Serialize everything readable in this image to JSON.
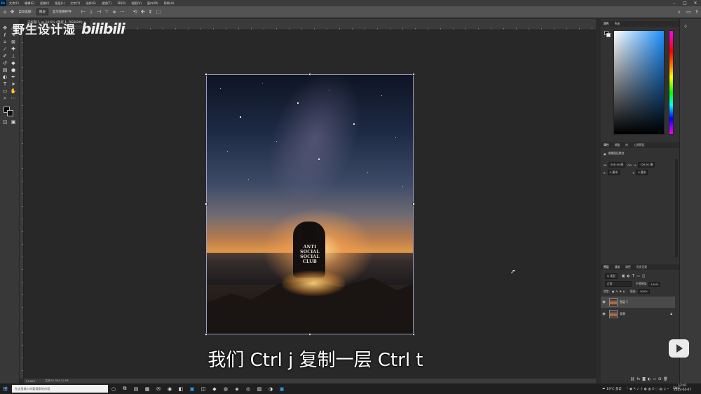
{
  "menubar": {
    "logo": "Ps",
    "items": [
      "文件(F)",
      "编辑(E)",
      "图像(I)",
      "图层(L)",
      "文字(Y)",
      "选择(S)",
      "滤镜(T)",
      "3D(D)",
      "视图(V)",
      "窗口(W)",
      "帮助(H)"
    ],
    "min": "–",
    "max": "□",
    "close": "✕"
  },
  "options": {
    "home": "⌂",
    "move": "✥",
    "auto_select": "自动选择:",
    "layer_dropdown": "图层",
    "show_transform": "显示变换控件",
    "more": "···"
  },
  "document": {
    "tab": "未标题-1 @ 24.6% (图层 1, RGB/8#) ×"
  },
  "watermark": {
    "text": "野生设计湿",
    "logo": "bilibili"
  },
  "subtitle": "我们 Ctrl j 复制一层 Ctrl t",
  "statusbar": {
    "zoom": "24.66%",
    "doc": "文档:55.7M/111.4M"
  },
  "panels": {
    "color_tabs": [
      "颜色",
      "色板"
    ],
    "properties_tabs": [
      "属性",
      "调整",
      "库",
      "工具预设"
    ],
    "properties_title": "像素图层属性",
    "w_label": "W:",
    "w_value": "506.49 厘",
    "h_label": "H:",
    "h_value": "126.91 厘",
    "go_label": "GO",
    "x_label": "X:",
    "x_value": "0 厘米",
    "y_label": "Y:",
    "y_value": "0 厘米",
    "layers_tabs": [
      "图层",
      "通道",
      "路径",
      "历史记录"
    ],
    "kind_label": "Q 类型",
    "blend_mode": "正常",
    "opacity_label": "不透明度:",
    "opacity_value": "100%",
    "lock_label": "锁定:",
    "fill_label": "填充:",
    "fill_value": "100%",
    "layers": [
      {
        "name": "图层 1",
        "selected": true
      },
      {
        "name": "背景",
        "selected": false
      }
    ]
  },
  "taskbar": {
    "search_placeholder": "在这里输入你要搜索的内容",
    "weather": "19°C 多云",
    "lang": "ENG",
    "time": "12:41",
    "date": "2022-04-07"
  },
  "colors": {
    "accent": "#31a8ff",
    "panel_bg": "#323232",
    "canvas_bg": "#282828"
  }
}
